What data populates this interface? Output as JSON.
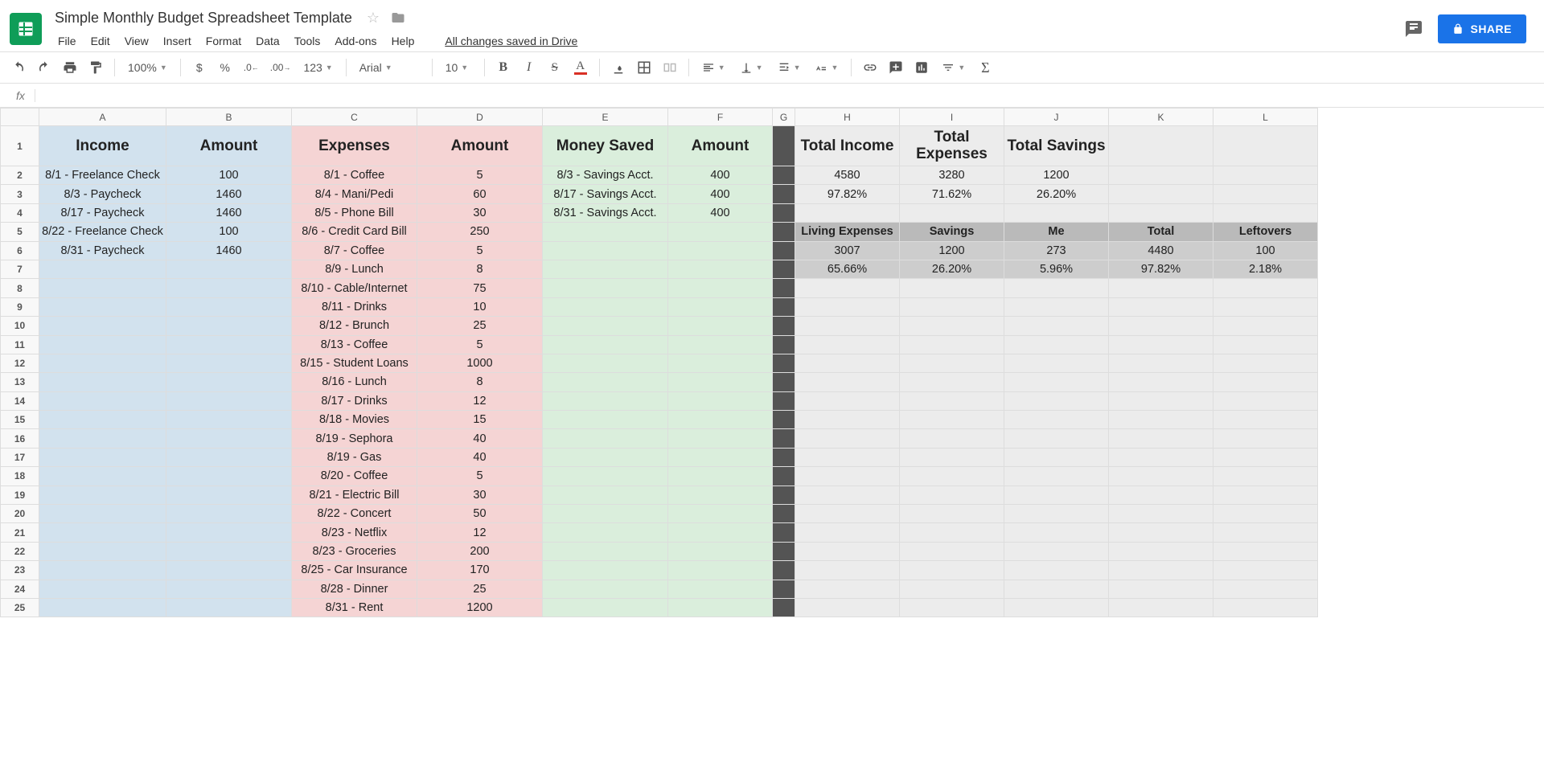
{
  "doc": {
    "title": "Simple Monthly Budget Spreadsheet Template",
    "save_status": "All changes saved in Drive"
  },
  "menu": [
    "File",
    "Edit",
    "View",
    "Insert",
    "Format",
    "Data",
    "Tools",
    "Add-ons",
    "Help"
  ],
  "toolbar": {
    "zoom": "100%",
    "font": "Arial",
    "size": "10"
  },
  "share": {
    "label": "SHARE"
  },
  "columns": [
    "A",
    "B",
    "C",
    "D",
    "E",
    "F",
    "G",
    "H",
    "I",
    "J",
    "K",
    "L"
  ],
  "sheet": {
    "headers": {
      "A": "Income",
      "B": "Amount",
      "C": "Expenses",
      "D": "Amount",
      "E": "Money Saved",
      "F": "Amount",
      "H": "Total Income",
      "I": "Total Expenses",
      "J": "Total Savings"
    },
    "income": [
      {
        "label": "8/1 - Freelance Check",
        "amount": "100"
      },
      {
        "label": "8/3 - Paycheck",
        "amount": "1460"
      },
      {
        "label": "8/17 - Paycheck",
        "amount": "1460"
      },
      {
        "label": "8/22 - Freelance Check",
        "amount": "100"
      },
      {
        "label": "8/31 - Paycheck",
        "amount": "1460"
      }
    ],
    "expenses": [
      {
        "label": "8/1 - Coffee",
        "amount": "5"
      },
      {
        "label": "8/4 - Mani/Pedi",
        "amount": "60"
      },
      {
        "label": "8/5 - Phone Bill",
        "amount": "30"
      },
      {
        "label": "8/6 - Credit Card Bill",
        "amount": "250"
      },
      {
        "label": "8/7 - Coffee",
        "amount": "5"
      },
      {
        "label": "8/9 - Lunch",
        "amount": "8"
      },
      {
        "label": "8/10 - Cable/Internet",
        "amount": "75"
      },
      {
        "label": "8/11 - Drinks",
        "amount": "10"
      },
      {
        "label": "8/12 - Brunch",
        "amount": "25"
      },
      {
        "label": "8/13 - Coffee",
        "amount": "5"
      },
      {
        "label": "8/15 - Student Loans",
        "amount": "1000"
      },
      {
        "label": "8/16 - Lunch",
        "amount": "8"
      },
      {
        "label": "8/17 - Drinks",
        "amount": "12"
      },
      {
        "label": "8/18 - Movies",
        "amount": "15"
      },
      {
        "label": "8/19 - Sephora",
        "amount": "40"
      },
      {
        "label": "8/19 - Gas",
        "amount": "40"
      },
      {
        "label": "8/20 - Coffee",
        "amount": "5"
      },
      {
        "label": "8/21 - Electric Bill",
        "amount": "30"
      },
      {
        "label": "8/22 - Concert",
        "amount": "50"
      },
      {
        "label": "8/23 - Netflix",
        "amount": "12"
      },
      {
        "label": "8/23 - Groceries",
        "amount": "200"
      },
      {
        "label": "8/25 - Car Insurance",
        "amount": "170"
      },
      {
        "label": "8/28 - Dinner",
        "amount": "25"
      },
      {
        "label": "8/31 - Rent",
        "amount": "1200"
      }
    ],
    "savings": [
      {
        "label": "8/3 - Savings Acct.",
        "amount": "400"
      },
      {
        "label": "8/17 - Savings Acct.",
        "amount": "400"
      },
      {
        "label": "8/31 - Savings Acct.",
        "amount": "400"
      }
    ],
    "totals": {
      "row2": {
        "H": "4580",
        "I": "3280",
        "J": "1200"
      },
      "row3": {
        "H": "97.82%",
        "I": "71.62%",
        "J": "26.20%"
      }
    },
    "summary": {
      "hdr": {
        "H": "Living Expenses",
        "I": "Savings",
        "J": "Me",
        "K": "Total",
        "L": "Leftovers"
      },
      "row6": {
        "H": "3007",
        "I": "1200",
        "J": "273",
        "K": "4480",
        "L": "100"
      },
      "row7": {
        "H": "65.66%",
        "I": "26.20%",
        "J": "5.96%",
        "K": "97.82%",
        "L": "2.18%"
      }
    }
  },
  "chart_data": {
    "type": "table",
    "title": "Simple Monthly Budget",
    "income_total": 4580,
    "expenses_total": 3280,
    "savings_total": 1200,
    "income": [
      [
        "8/1 - Freelance Check",
        100
      ],
      [
        "8/3 - Paycheck",
        1460
      ],
      [
        "8/17 - Paycheck",
        1460
      ],
      [
        "8/22 - Freelance Check",
        100
      ],
      [
        "8/31 - Paycheck",
        1460
      ]
    ],
    "expenses": [
      [
        "8/1 - Coffee",
        5
      ],
      [
        "8/4 - Mani/Pedi",
        60
      ],
      [
        "8/5 - Phone Bill",
        30
      ],
      [
        "8/6 - Credit Card Bill",
        250
      ],
      [
        "8/7 - Coffee",
        5
      ],
      [
        "8/9 - Lunch",
        8
      ],
      [
        "8/10 - Cable/Internet",
        75
      ],
      [
        "8/11 - Drinks",
        10
      ],
      [
        "8/12 - Brunch",
        25
      ],
      [
        "8/13 - Coffee",
        5
      ],
      [
        "8/15 - Student Loans",
        1000
      ],
      [
        "8/16 - Lunch",
        8
      ],
      [
        "8/17 - Drinks",
        12
      ],
      [
        "8/18 - Movies",
        15
      ],
      [
        "8/19 - Sephora",
        40
      ],
      [
        "8/19 - Gas",
        40
      ],
      [
        "8/20 - Coffee",
        5
      ],
      [
        "8/21 - Electric Bill",
        30
      ],
      [
        "8/22 - Concert",
        50
      ],
      [
        "8/23 - Netflix",
        12
      ],
      [
        "8/23 - Groceries",
        200
      ],
      [
        "8/25 - Car Insurance",
        170
      ],
      [
        "8/28 - Dinner",
        25
      ],
      [
        "8/31 - Rent",
        1200
      ]
    ],
    "savings": [
      [
        "8/3 - Savings Acct.",
        400
      ],
      [
        "8/17 - Savings Acct.",
        400
      ],
      [
        "8/31 - Savings Acct.",
        400
      ]
    ],
    "percentages": {
      "income": 97.82,
      "expenses": 71.62,
      "savings": 26.2
    },
    "summary": {
      "living_expenses": 3007,
      "savings": 1200,
      "me": 273,
      "total": 4480,
      "leftovers": 100,
      "pct": {
        "living_expenses": 65.66,
        "savings": 26.2,
        "me": 5.96,
        "total": 97.82,
        "leftovers": 2.18
      }
    }
  }
}
